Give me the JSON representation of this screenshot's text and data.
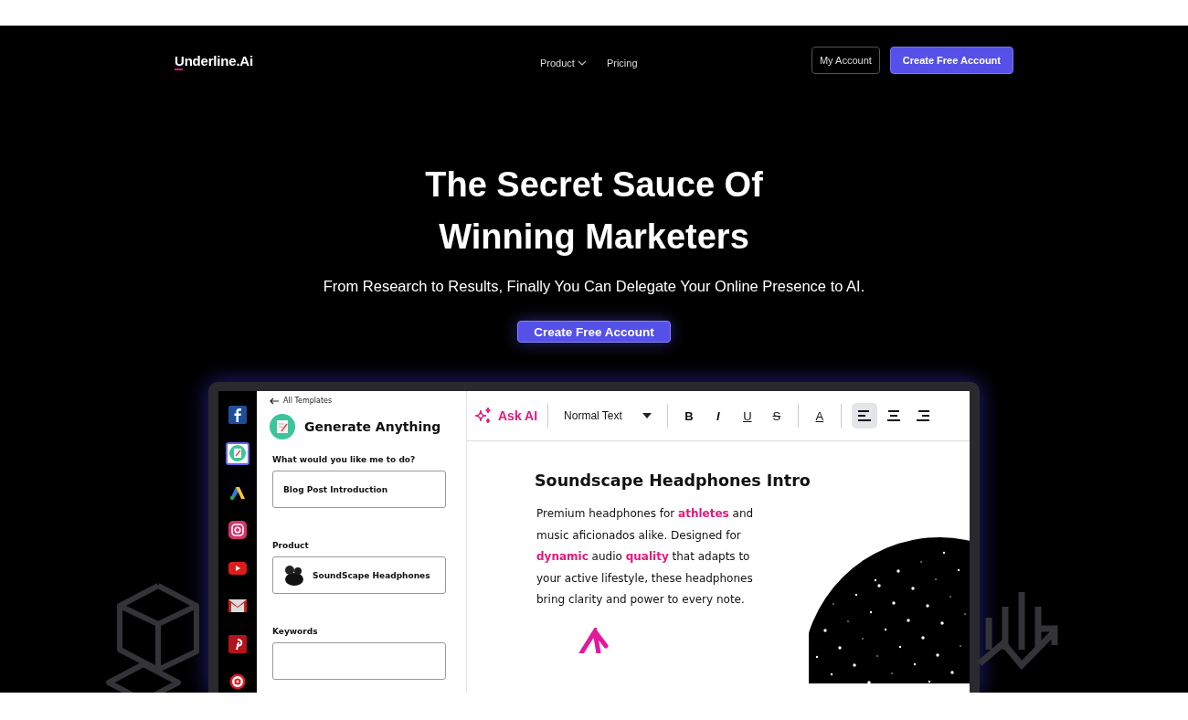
{
  "nav": {
    "logo": "Underline.Ai",
    "links": [
      {
        "label": "Product",
        "kind": "dropdown"
      },
      {
        "label": "Pricing",
        "kind": "link"
      }
    ],
    "buttons": [
      {
        "label": "My Account",
        "kind": "outline"
      },
      {
        "label": "Create Free Account",
        "kind": "primary"
      }
    ]
  },
  "hero": {
    "title_lines": [
      "The Secret Sauce Of",
      "Winning Marketers"
    ],
    "subtitle": "From Research to Results, Finally You Can Delegate Your Online Presence to AI.",
    "cta": "Create Free Account"
  },
  "app": {
    "rail": [
      {
        "kind": "facebook",
        "selected": false
      },
      {
        "kind": "document",
        "selected": true
      },
      {
        "kind": "ads",
        "selected": false
      },
      {
        "kind": "instagram",
        "selected": false
      },
      {
        "kind": "video",
        "selected": false
      },
      {
        "kind": "mail",
        "selected": false
      },
      {
        "kind": "pinterest",
        "selected": false
      },
      {
        "kind": "target",
        "selected": false
      }
    ],
    "panel": {
      "back": "All Templates",
      "title": "Generate Anything",
      "fields": [
        {
          "label": "What would you like me to do?",
          "value": "Blog Post Introduction",
          "kind": "text"
        },
        {
          "label": "Product",
          "value": "SoundScape Headphones",
          "kind": "product"
        },
        {
          "label": "Keywords",
          "kind": "text"
        }
      ]
    },
    "toolbar": {
      "ask_ai": "Ask AI",
      "style": "Normal Text",
      "format": [
        {
          "label": "B",
          "kind": "bold"
        },
        {
          "label": "I",
          "kind": "italic"
        },
        {
          "label": "U",
          "kind": "underline"
        },
        {
          "label": "S",
          "kind": "strike"
        }
      ],
      "text_color": "A",
      "align": [
        {
          "kind": "left",
          "selected": true
        },
        {
          "kind": "center",
          "selected": false
        },
        {
          "kind": "right",
          "selected": false
        }
      ]
    },
    "doc": {
      "title": "Soundscape Headphones Intro",
      "body": "Premium headphones for **athletes** and music aficionados alike. Designed for **dynamic** audio **quality** that adapts to your active lifestyle, these headphones bring clarity and power to every note."
    }
  }
}
